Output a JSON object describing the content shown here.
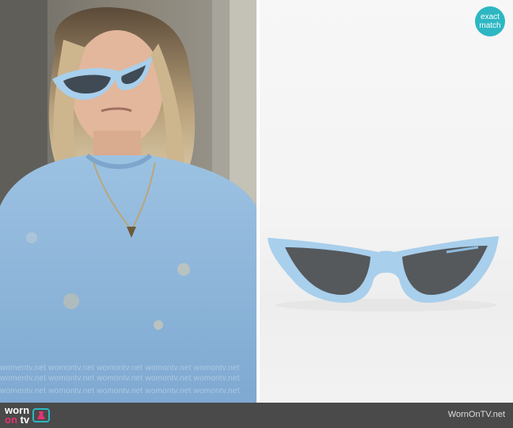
{
  "badge": {
    "line1": "exact",
    "line2": "match"
  },
  "watermark": {
    "text": "womentv.net womontv.net womontv.net womontv.net womontv.net"
  },
  "footer": {
    "logo_worn": "worn",
    "logo_on": "on",
    "logo_tv": "tv",
    "site": "WornOnTV.net"
  },
  "colors": {
    "footer_bg": "#4a4a4a",
    "badge_bg": "#2db7c2",
    "sunglasses_frame": "#a8cfec",
    "sweater": "#8fb7db",
    "logo_accent": "#e6336f"
  }
}
